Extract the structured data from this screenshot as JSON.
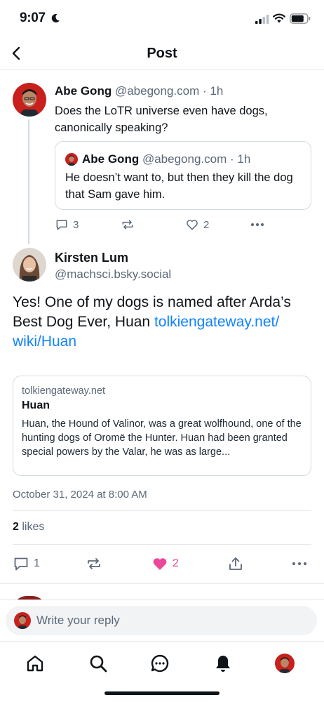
{
  "status_bar": {
    "time": "9:07"
  },
  "header": {
    "title": "Post"
  },
  "parent_post": {
    "author": "Abe Gong",
    "handle": "@abegong.com",
    "separator": "·",
    "age": "1h",
    "text": "Does the LoTR universe even have dogs, canonically speaking?",
    "quote": {
      "author": "Abe Gong",
      "handle": "@abegong.com",
      "separator": "·",
      "age": "1h",
      "text": "He doesn’t want to, but then they kill the dog that Sam gave him."
    },
    "actions": {
      "reply_count": "3",
      "like_count": "2"
    }
  },
  "main_post": {
    "author": "Kirsten Lum",
    "handle": "@machsci.bsky.social",
    "text": "Yes! One of my dogs is named after Arda’s Best Dog Ever, Huan ",
    "link_text": "tolkiengateway.net/\nwiki/Huan",
    "link_card": {
      "domain": "tolkiengateway.net",
      "title": "Huan",
      "description": "Huan, the Hound of Valinor, was a great wolfhound, one of the hunting dogs of Oromë the Hunter.  Huan had been granted special powers by the Valar, he was as large..."
    },
    "timestamp": "October 31, 2024 at 8:00 AM",
    "likes": {
      "count": "2",
      "label": " likes"
    },
    "actions": {
      "reply_count": "1",
      "like_count": "2"
    }
  },
  "reply_bar": {
    "placeholder": "Write your reply"
  },
  "colors": {
    "link": "#1083fe",
    "like_active": "#ec4899",
    "muted": "#5b6877"
  },
  "tab_bar": {
    "icons": [
      "home-icon",
      "search-icon",
      "chat-icon",
      "notifications-icon",
      "profile-avatar"
    ]
  }
}
